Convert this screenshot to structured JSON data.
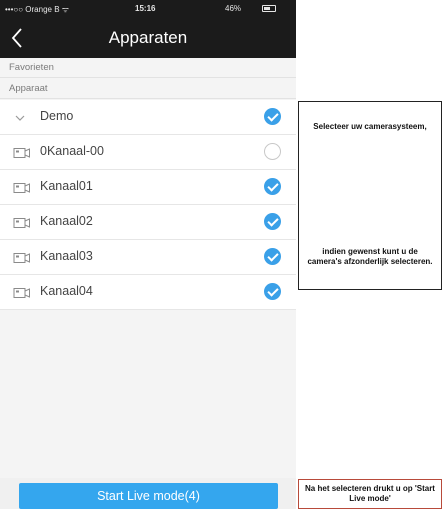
{
  "status_bar": {
    "carrier": "•••○○ Orange B ᯤ",
    "time": "15:16",
    "battery": "46%"
  },
  "nav": {
    "title": "Apparaten"
  },
  "sections": {
    "favorites": "Favorieten",
    "devices": "Apparaat"
  },
  "rows": [
    {
      "label": "Demo",
      "icon": "chevron-down-icon",
      "checked": true
    },
    {
      "label": "0Kanaal-00",
      "icon": "camera-icon",
      "checked": false
    },
    {
      "label": "Kanaal01",
      "icon": "camera-icon",
      "checked": true
    },
    {
      "label": "Kanaal02",
      "icon": "camera-icon",
      "checked": true
    },
    {
      "label": "Kanaal03",
      "icon": "camera-icon",
      "checked": true
    },
    {
      "label": "Kanaal04",
      "icon": "camera-icon",
      "checked": true
    }
  ],
  "start_button": {
    "label": "Start Live mode(4)"
  },
  "annotations": {
    "select_system": "Selecteer uw camerasysteem,",
    "select_individual": "indien gewenst kunt u de camera's afzonderlijk selecteren.",
    "after_select": "Na het selecteren drukt u op 'Start Live mode'"
  },
  "colors": {
    "accent": "#34a6ee",
    "check": "#3aa0e8",
    "navbar": "#1b1b1b"
  }
}
